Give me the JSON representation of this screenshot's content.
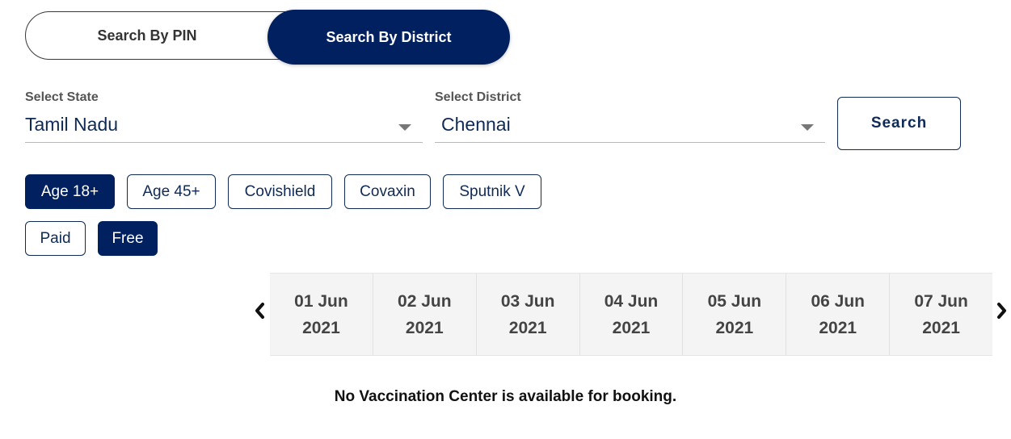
{
  "search_mode": {
    "options": [
      "Search By PIN",
      "Search By District"
    ],
    "selected": "Search By District"
  },
  "state_select": {
    "label": "Select State",
    "value": "Tamil Nadu"
  },
  "district_select": {
    "label": "Select District",
    "value": "Chennai"
  },
  "search_button": "Search",
  "filters": {
    "row1": [
      {
        "label": "Age 18+",
        "active": true
      },
      {
        "label": "Age 45+",
        "active": false
      },
      {
        "label": "Covishield",
        "active": false
      },
      {
        "label": "Covaxin",
        "active": false
      },
      {
        "label": "Sputnik V",
        "active": false
      }
    ],
    "row2": [
      {
        "label": "Paid",
        "active": false
      },
      {
        "label": "Free",
        "active": true
      }
    ]
  },
  "dates": [
    {
      "day": "01 Jun",
      "year": "2021"
    },
    {
      "day": "02 Jun",
      "year": "2021"
    },
    {
      "day": "03 Jun",
      "year": "2021"
    },
    {
      "day": "04 Jun",
      "year": "2021"
    },
    {
      "day": "05 Jun",
      "year": "2021"
    },
    {
      "day": "06 Jun",
      "year": "2021"
    },
    {
      "day": "07 Jun",
      "year": "2021"
    }
  ],
  "icons": {
    "prev": "chevron-left-icon",
    "next": "chevron-right-icon",
    "dropdown": "caret-down-icon"
  },
  "message": "No Vaccination Center is available for booking.",
  "colors": {
    "primary": "#002060",
    "text_primary": "#0e2a55",
    "date_bg": "#f4f4f4"
  }
}
